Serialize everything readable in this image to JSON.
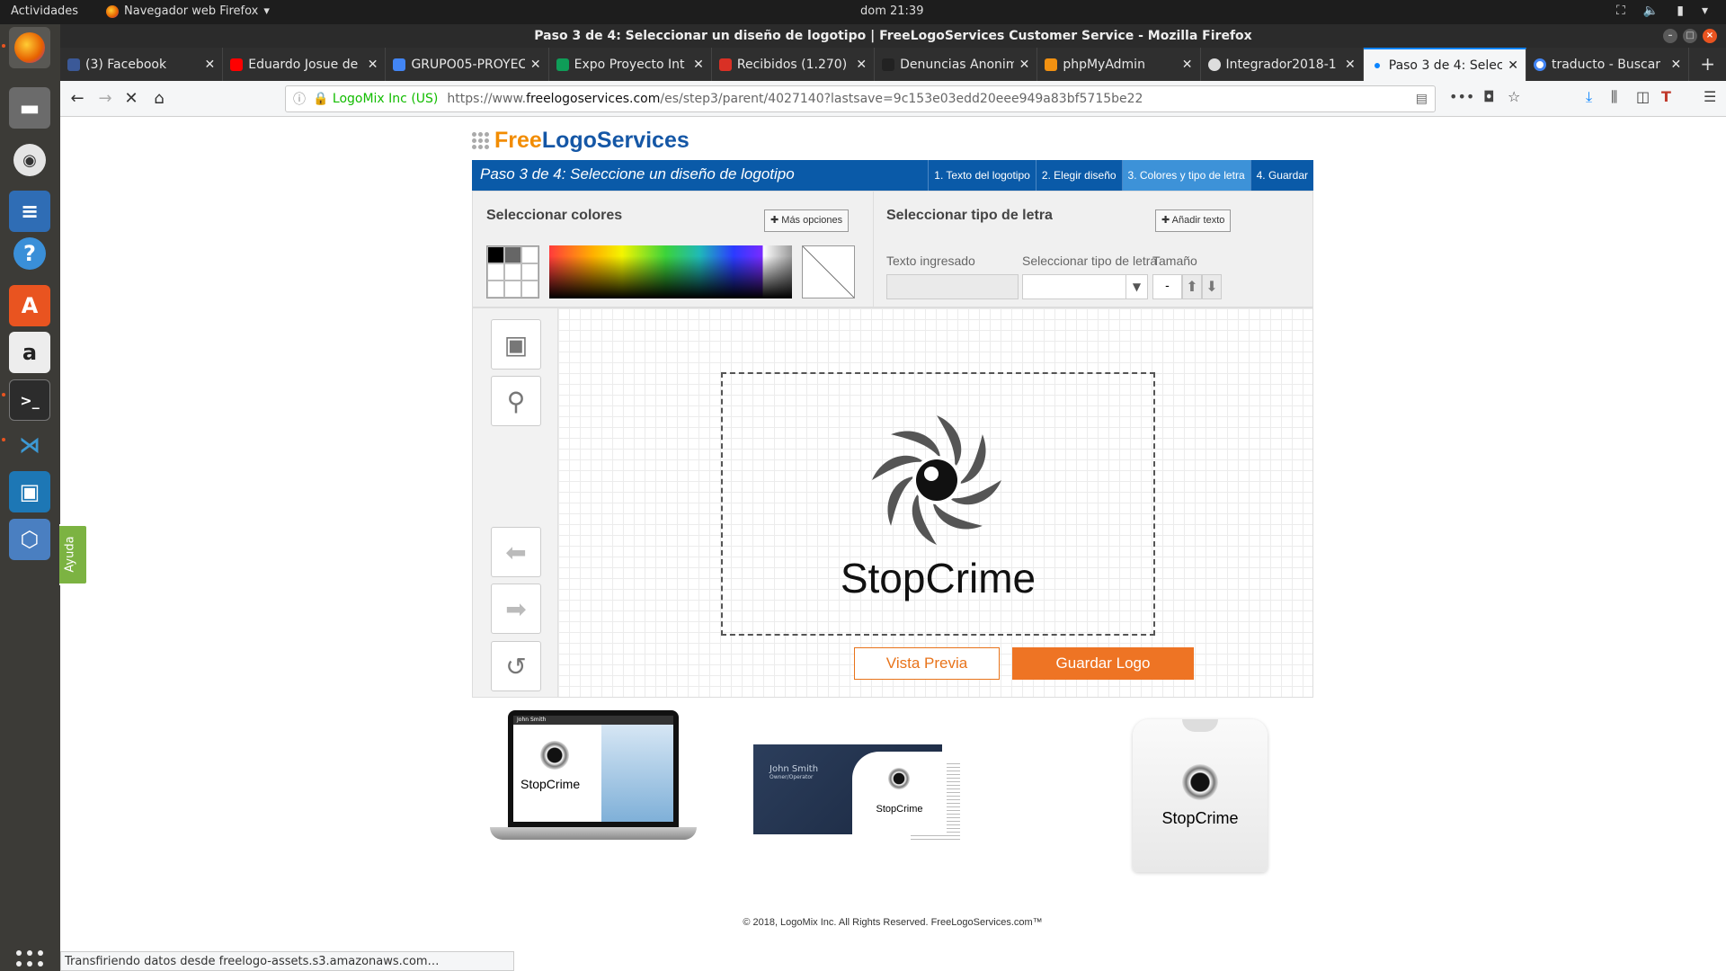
{
  "topbar": {
    "activities": "Actividades",
    "app_name": "Navegador web Firefox",
    "clock": "dom 21:39"
  },
  "window": {
    "title": "Paso 3 de 4: Seleccionar un diseño de logotipo | FreeLogoServices Customer Service - Mozilla Firefox"
  },
  "tabs": [
    {
      "label": "(3) Facebook",
      "color": "#3b5998"
    },
    {
      "label": "Eduardo Josue de",
      "color": "#ff0000"
    },
    {
      "label": "GRUPO05-PROYEC",
      "color": "#4285f4"
    },
    {
      "label": "Expo Proyecto Int",
      "color": "#0f9d58"
    },
    {
      "label": "Recibidos (1.270)",
      "color": "#d93025"
    },
    {
      "label": "Denuncias Anonim",
      "color": "#222222"
    },
    {
      "label": "phpMyAdmin",
      "color": "#f29111"
    },
    {
      "label": "Integrador2018-1",
      "color": "#24292e"
    },
    {
      "label": "Paso 3 de 4: Selec",
      "color": "#0a84ff",
      "active": true
    },
    {
      "label": "traducto - Buscar",
      "color": "#4285f4"
    }
  ],
  "urlbar": {
    "identity": "LogoMix Inc (US)",
    "url_prefix": "https://www.",
    "url_domain": "freelogoservices.com",
    "url_path": "/es/step3/parent/4027140?lastsave=9c153e03edd20eee949a83bf5715be22"
  },
  "site": {
    "logo_free": "Free",
    "logo_rest": "LogoServices",
    "step_title": "Paso 3 de 4: Seleccione un diseño de logotipo",
    "steps": [
      {
        "label": "1. Texto del logotipo"
      },
      {
        "label": "2. Elegir diseño"
      },
      {
        "label": "3. Colores y tipo de letra",
        "current": true
      },
      {
        "label": "4. Guardar"
      }
    ],
    "colors_title": "Seleccionar colores",
    "more_options": "Más opciones",
    "fonts_title": "Seleccionar tipo de letra",
    "add_text": "Añadir texto",
    "entered_text_label": "Texto ingresado",
    "font_select_label": "Seleccionar tipo de letra",
    "size_label": "Tamaño",
    "size_value": "-",
    "logo_text": "StopCrime",
    "preview_button": "Vista Previa",
    "save_button": "Guardar Logo",
    "mockup_card_name": "John Smith",
    "mockup_card_title": "Owner/Operator",
    "mockup_laptop_url": "www.YOURDOMAIN.com",
    "copyright": "© 2018, LogoMix Inc. All Rights Reserved. FreeLogoServices.com™"
  },
  "help_tab": "Ayuda",
  "status": "Transfiriendo datos desde freelogo-assets.s3.amazonaws.com…"
}
